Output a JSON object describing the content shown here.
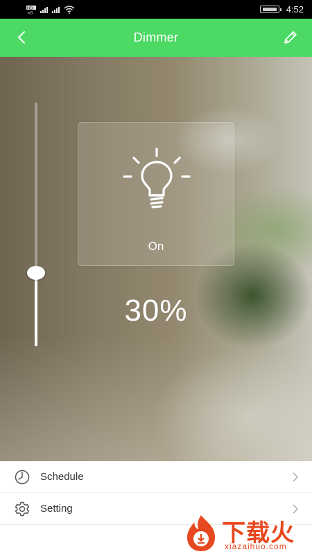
{
  "status_bar": {
    "left_icons": [
      "hd-icon",
      "signal-icon",
      "signal-icon",
      "wifi-icon"
    ],
    "time": "4:52"
  },
  "header": {
    "title": "Dimmer",
    "back_icon": "chevron-left-icon",
    "edit_icon": "pencil-icon",
    "background_color": "#4cd964"
  },
  "dimmer": {
    "state_label": "On",
    "brightness_text": "30%",
    "brightness_value": 0.3,
    "bulb_icon": "lightbulb-icon"
  },
  "menu": {
    "items": [
      {
        "label": "Schedule",
        "icon": "clock-icon"
      },
      {
        "label": "Setting",
        "icon": "gear-icon"
      }
    ]
  },
  "watermark": {
    "title": "下载火",
    "subtitle": "xiazaihuo.com",
    "color": "#e8481f"
  }
}
